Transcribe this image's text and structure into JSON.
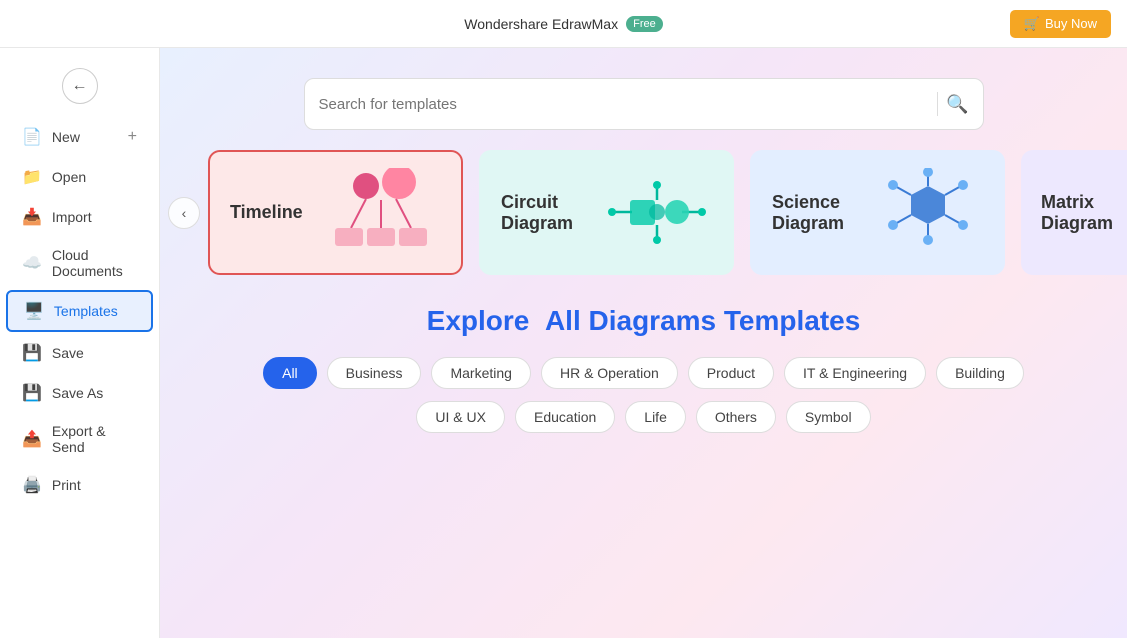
{
  "topbar": {
    "title": "Wondershare EdrawMax",
    "badge": "Free",
    "buy_label": "Buy Now"
  },
  "sidebar": {
    "back_label": "←",
    "items": [
      {
        "id": "new",
        "label": "New",
        "icon": "➕",
        "has_plus": true
      },
      {
        "id": "open",
        "label": "Open",
        "icon": "📁"
      },
      {
        "id": "import",
        "label": "Import",
        "icon": "📥"
      },
      {
        "id": "cloud",
        "label": "Cloud Documents",
        "icon": "☁️"
      },
      {
        "id": "templates",
        "label": "Templates",
        "icon": "🖥️",
        "active": true
      },
      {
        "id": "save",
        "label": "Save",
        "icon": "💾"
      },
      {
        "id": "saveas",
        "label": "Save As",
        "icon": "💾"
      },
      {
        "id": "export",
        "label": "Export & Send",
        "icon": "📤"
      },
      {
        "id": "print",
        "label": "Print",
        "icon": "🖨️"
      }
    ]
  },
  "search": {
    "placeholder": "Search for templates"
  },
  "carousel": {
    "cards": [
      {
        "id": "timeline",
        "label": "Timeline",
        "style": "pink"
      },
      {
        "id": "circuit",
        "label": "Circuit Diagram",
        "style": "teal"
      },
      {
        "id": "science",
        "label": "Science Diagram",
        "style": "blue-light"
      },
      {
        "id": "matrix",
        "label": "Matrix Diagram",
        "style": "purple-light"
      }
    ]
  },
  "explore": {
    "title_static": "Explore",
    "title_highlight": "All Diagrams Templates",
    "filters_row1": [
      {
        "id": "all",
        "label": "All",
        "active": true
      },
      {
        "id": "business",
        "label": "Business",
        "active": false
      },
      {
        "id": "marketing",
        "label": "Marketing",
        "active": false
      },
      {
        "id": "hr",
        "label": "HR & Operation",
        "active": false
      },
      {
        "id": "product",
        "label": "Product",
        "active": false
      },
      {
        "id": "it",
        "label": "IT & Engineering",
        "active": false
      },
      {
        "id": "building",
        "label": "Building",
        "active": false
      }
    ],
    "filters_row2": [
      {
        "id": "ui",
        "label": "UI & UX",
        "active": false
      },
      {
        "id": "education",
        "label": "Education",
        "active": false
      },
      {
        "id": "life",
        "label": "Life",
        "active": false
      },
      {
        "id": "others",
        "label": "Others",
        "active": false
      },
      {
        "id": "symbol",
        "label": "Symbol",
        "active": false
      }
    ]
  }
}
